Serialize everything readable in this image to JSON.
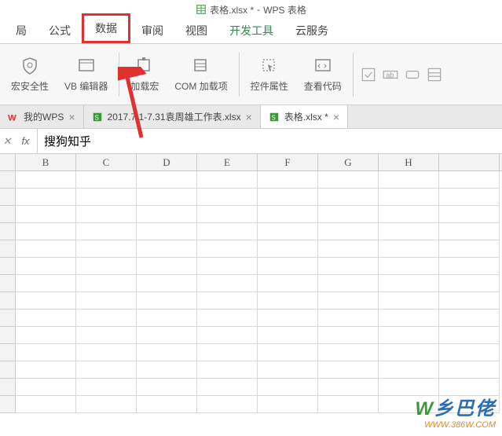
{
  "title": {
    "filename": "表格.xlsx *",
    "app": "WPS 表格"
  },
  "ribbon_tabs": [
    "局",
    "公式",
    "数据",
    "审阅",
    "视图",
    "开发工具",
    "云服务"
  ],
  "toolbar": {
    "macro_security": "宏安全性",
    "vb_editor": "VB 编辑器",
    "load_macro": "加载宏",
    "com_addin": "COM 加载项",
    "control_props": "控件属性",
    "view_code": "查看代码"
  },
  "doc_tabs": [
    {
      "label": "我的WPS",
      "type": "wps"
    },
    {
      "label": "2017.7.1-7.31袁周雄工作表.xlsx",
      "type": "xls"
    },
    {
      "label": "表格.xlsx *",
      "type": "xls",
      "active": true
    }
  ],
  "formula": {
    "fx": "fx",
    "value": "搜狗知乎"
  },
  "columns": [
    "B",
    "C",
    "D",
    "E",
    "F",
    "G",
    "H"
  ],
  "watermark": {
    "text": "乡巴佬",
    "url": "WWW.386W.COM"
  }
}
